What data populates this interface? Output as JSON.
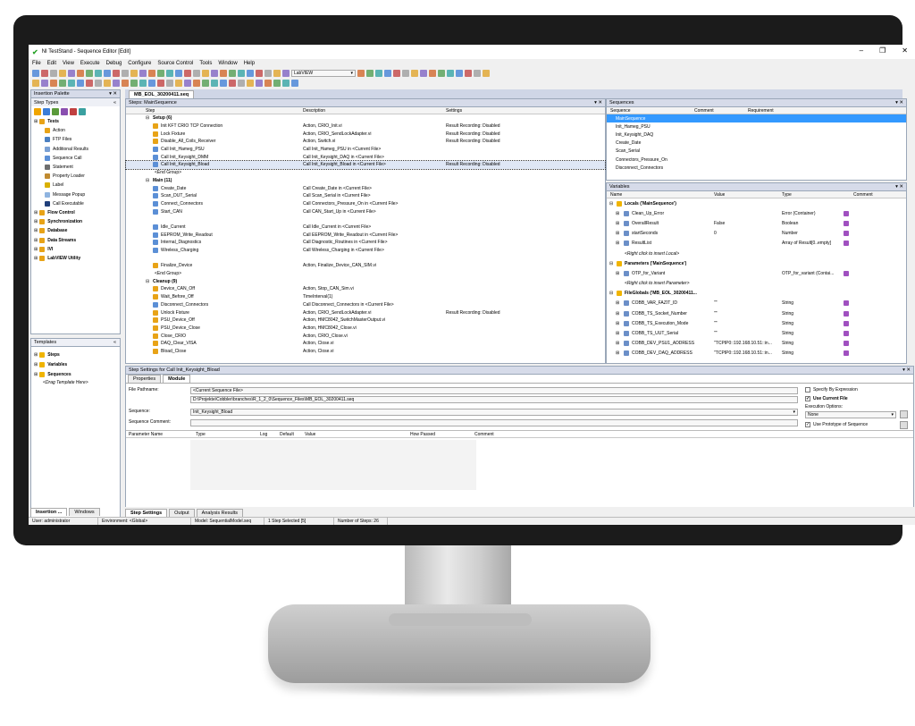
{
  "window": {
    "title": "NI TestStand - Sequence Editor [Edit]",
    "min": "–",
    "max": "❐",
    "close": "✕"
  },
  "menu": [
    "File",
    "Edit",
    "View",
    "Execute",
    "Debug",
    "Configure",
    "Source Control",
    "Tools",
    "Window",
    "Help"
  ],
  "toolbar": {
    "adapter": "LabVIEW"
  },
  "insertion": {
    "title": "Insertion Palette",
    "section": "Step Types",
    "items": [
      {
        "label": "Tests",
        "bold": true,
        "color": "#e8a317"
      },
      {
        "label": "Action",
        "color": "#e8a317"
      },
      {
        "label": "FTP Files",
        "color": "#4a7fc1"
      },
      {
        "label": "Additional Results",
        "color": "#7aa0d4"
      },
      {
        "label": "Sequence Call",
        "color": "#5b8fd6"
      },
      {
        "label": "Statement",
        "color": "#6e6e6e"
      },
      {
        "label": "Property Loader",
        "color": "#c08a30"
      },
      {
        "label": "Label",
        "color": "#d9b000"
      },
      {
        "label": "Message Popup",
        "color": "#8fb4e0"
      },
      {
        "label": "Call Executable",
        "color": "#1f3f7a"
      },
      {
        "label": "Flow Control",
        "bold": true,
        "color": "#e8a317"
      },
      {
        "label": "Synchronization",
        "bold": true,
        "color": "#e8a317"
      },
      {
        "label": "Database",
        "bold": true,
        "color": "#e8a317"
      },
      {
        "label": "Data Streams",
        "bold": true,
        "color": "#e8a317"
      },
      {
        "label": "IVI",
        "bold": true,
        "color": "#e8a317"
      },
      {
        "label": "LabVIEW Utility",
        "bold": true,
        "color": "#e8a317"
      }
    ]
  },
  "templates": {
    "title": "Templates",
    "items": [
      "Steps",
      "Variables",
      "Sequences"
    ],
    "hint": "<Drag Template Here>"
  },
  "lefttabs": [
    "Insertion ...",
    "Windows"
  ],
  "seqfile": {
    "tab": "MB_EOL_30200411.seq",
    "title": "Steps: MainSequence",
    "cols": [
      "Step",
      "Description",
      "Settings"
    ],
    "rows": [
      {
        "s": "Setup (6)",
        "g": true
      },
      {
        "s": "Init KFT CRIO TCP Connection",
        "d": "Action,  CRIO_Init.vi",
        "x": "Result Recording: Disabled"
      },
      {
        "s": "Lock Fixture",
        "d": "Action,  CRIO_SendLockAdapter.vi",
        "x": "Result Recording: Disabled"
      },
      {
        "s": "Disable_All_Coils_Receiver",
        "d": "Action,  Switch.vi",
        "x": "Result Recording: Disabled"
      },
      {
        "s": "Call Init_Hameg_PSU",
        "d": "Call Init_Hameg_PSU in <Current File>",
        "x": ""
      },
      {
        "s": "Call Init_Keysight_DMM",
        "d": "Call Init_Keysight_DAQ in <Current File>",
        "x": ""
      },
      {
        "s": "Call Init_Keysight_Bload",
        "d": "Call Init_Keysight_Bload in <Current File>",
        "x": "Result Recording: Disabled",
        "sel": true
      },
      {
        "s": "<End Group>",
        "e": true
      },
      {
        "s": "Main (11)",
        "g": true
      },
      {
        "s": "Create_Date",
        "d": "Call Create_Date in <Current File>",
        "x": ""
      },
      {
        "s": "Scan_DUT_Serial",
        "d": "Call Scan_Serial in <Current File>",
        "x": ""
      },
      {
        "s": "Connect_Connectors",
        "d": "Call Connectors_Pressure_On in <Current File>",
        "x": ""
      },
      {
        "s": "Start_CAN",
        "d": "Call CAN_Start_Up in <Current File>",
        "x": ""
      },
      {
        "s": "",
        "d": "",
        "x": ""
      },
      {
        "s": "Idle_Current",
        "d": "Call Idle_Current in <Current File>",
        "x": ""
      },
      {
        "s": "EEPROM_Write_Readout",
        "d": "Call EEPROM_Write_Readout in <Current File>",
        "x": ""
      },
      {
        "s": "Internal_Diagnostics",
        "d": "Call Diagnostic_Routines in <Current File>",
        "x": ""
      },
      {
        "s": "Wireless_Charging",
        "d": "Call Wireless_Charging in <Current File>",
        "x": ""
      },
      {
        "s": "",
        "d": "",
        "x": ""
      },
      {
        "s": "Finalize_Device",
        "d": "Action,  Finalize_Device_CAN_SIM.vi",
        "x": ""
      },
      {
        "s": "<End Group>",
        "e": true
      },
      {
        "s": "Cleanup (9)",
        "g": true
      },
      {
        "s": "Device_CAN_Off",
        "d": "Action,  Stop_CAN_Sim.vi",
        "x": ""
      },
      {
        "s": "Wait_Before_Off",
        "d": "TimeInterval(1)",
        "x": ""
      },
      {
        "s": "Disconnect_Connectors",
        "d": "Call Disconnect_Connectors in <Current File>",
        "x": ""
      },
      {
        "s": "Unlock Fixture",
        "d": "Action,  CRIO_SendLockAdapter.vi",
        "x": "Result Recording: Disabled"
      },
      {
        "s": "PSU_Device_Off",
        "d": "Action,  HMC8042_SwitchMasterOutput.vi",
        "x": ""
      },
      {
        "s": "PSU_Device_Close",
        "d": "Action,  HMC8042_Close.vi",
        "x": ""
      },
      {
        "s": "Close_CRIO",
        "d": "Action,  CRIO_Close.vi",
        "x": ""
      },
      {
        "s": "DAQ_Clear_VISA",
        "d": "Action,  Close.vi",
        "x": ""
      },
      {
        "s": "Bload_Close",
        "d": "Action,  Close.vi",
        "x": ""
      }
    ]
  },
  "sequences": {
    "title": "Sequences",
    "cols": [
      "Sequence",
      "Comment",
      "Requirement"
    ],
    "items": [
      "MainSequence",
      "Init_Hameg_PSU",
      "Init_Keysight_DAQ",
      "Create_Date",
      "Scan_Serial",
      "Connectors_Pressure_On",
      "Disconnect_Connectors"
    ]
  },
  "variables": {
    "title": "Variables",
    "cols": [
      "Name",
      "Value",
      "Type",
      "Comment"
    ],
    "rows": [
      {
        "n": "Locals ('MainSequence')",
        "h": true
      },
      {
        "n": "Clean_Up_Error",
        "v": "",
        "t": "Error (Container)",
        "i": 1
      },
      {
        "n": "OverallResult",
        "v": "False",
        "t": "Boolean",
        "i": 1
      },
      {
        "n": "startSeconds",
        "v": "0",
        "t": "Number",
        "i": 1
      },
      {
        "n": "ResultList",
        "v": "",
        "t": "Array of Result[0..empty]",
        "i": 1
      },
      {
        "n": "<Right click to insert Local>",
        "hint": true
      },
      {
        "n": "Parameters ('MainSequence')",
        "h": true
      },
      {
        "n": "OTP_for_Variant",
        "v": "",
        "t": "OTP_for_variant (Contai...",
        "i": 1
      },
      {
        "n": "<Right click to insert Parameter>",
        "hint": true
      },
      {
        "n": "FileGlobals ('MB_EOL_30200411...",
        "h": true
      },
      {
        "n": "COBB_VAR_FAZIT_ID",
        "v": "\"\"",
        "t": "String",
        "i": 1
      },
      {
        "n": "COBB_TS_Socket_Number",
        "v": "\"\"",
        "t": "String",
        "i": 1
      },
      {
        "n": "COBB_TS_Execution_Mode",
        "v": "\"\"",
        "t": "String",
        "i": 1
      },
      {
        "n": "COBB_TS_UUT_Serial",
        "v": "\"\"",
        "t": "String",
        "i": 1
      },
      {
        "n": "COBB_DEV_PSU1_ADDRESS",
        "v": "\"TCPIP0::192.168.10.51::in...",
        "t": "String",
        "i": 1
      },
      {
        "n": "COBB_DEV_DAQ_ADDRESS",
        "v": "\"TCPIP0::192.168.10.51::in...",
        "t": "String",
        "i": 1
      }
    ]
  },
  "settings": {
    "title": "Step Settings for Call Init_Keysight_Bload",
    "tabs": [
      "Properties",
      "Module"
    ],
    "file_label": "File Pathname:",
    "file_value": "<Current Sequence File>",
    "path": "D:\\Projekte\\Cobbler\\branches\\R_1_2_0\\Sequence_Files\\MB_EOL_30200411.seq",
    "seq_label": "Sequence:",
    "seq_value": "Init_Keysight_Bload",
    "comment_label": "Sequence Comment:",
    "specify": "Specify By Expression",
    "use_current": "Use Current File",
    "exec_label": "Execution Options:",
    "exec_value": "None",
    "use_proto": "Use Prototype of Sequence",
    "param_cols": [
      "Parameter Name",
      "Type",
      "Log",
      "Default",
      "Value",
      "How Passed",
      "Comment"
    ]
  },
  "bottomtabs": [
    "Step Settings",
    "Output",
    "Analysis Results"
  ],
  "status": [
    "User: administrator",
    "Environment: <Global>",
    "Model: SequentialModel.seq",
    "1 Step Selected [5]",
    "Number of Steps: 26"
  ]
}
